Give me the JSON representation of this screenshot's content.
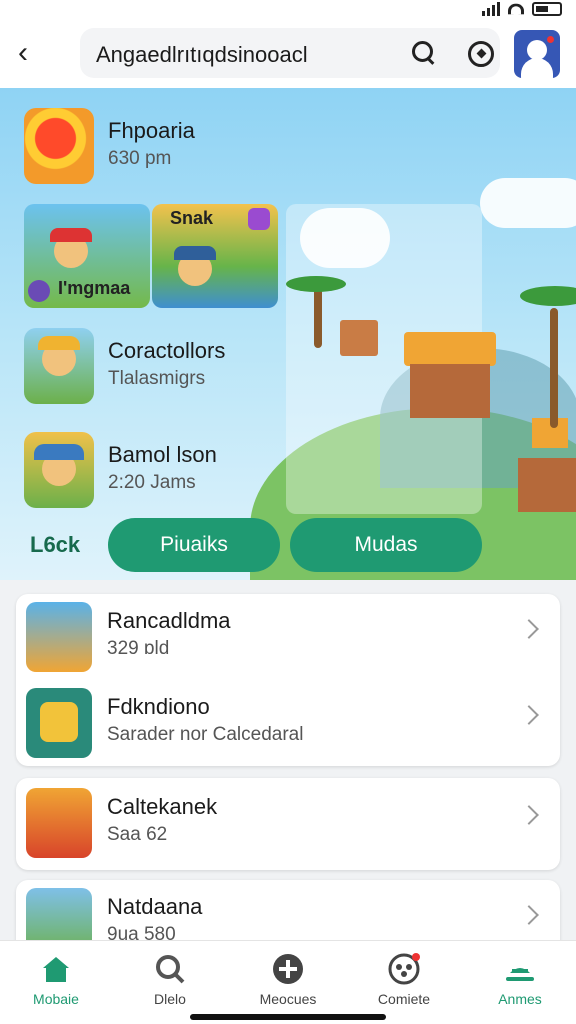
{
  "header": {
    "search_text": "Angaedlrıtıqdsinooacl"
  },
  "hero": {
    "top_game": {
      "title": "Fhpoaria",
      "subtitle": "630 pm"
    },
    "featured": [
      {
        "label": "I'mgmaa"
      },
      {
        "label": "Snak"
      }
    ],
    "games": [
      {
        "title": "Coractollors",
        "subtitle": "Tlalasmigrs"
      },
      {
        "title": "Bamol lson",
        "subtitle": "2:20 Jams"
      }
    ],
    "look_label": "L6ck",
    "buttons": [
      {
        "label": "Piuaiks"
      },
      {
        "label": "Mudas"
      }
    ]
  },
  "list": [
    {
      "title": "Rancadldma",
      "subtitle": "329 ɒld"
    },
    {
      "title": "Fdkndiono",
      "subtitle": "Sarader nor Calcedaral"
    },
    {
      "title": "Caltekanek",
      "subtitle": "Saa 62"
    },
    {
      "title": "Natdaana",
      "subtitle": "9ua 580"
    }
  ],
  "nav": [
    {
      "label": "Mobaie",
      "icon": "home-icon",
      "active": true
    },
    {
      "label": "Dlelo",
      "icon": "search-icon",
      "active": false
    },
    {
      "label": "Meocues",
      "icon": "plus-icon",
      "active": false
    },
    {
      "label": "Comiete",
      "icon": "gamepad-icon",
      "active": false
    },
    {
      "label": "Anmes",
      "icon": "ship-icon",
      "active": false
    }
  ],
  "colors": {
    "accent": "#1f9a72",
    "brand_dark": "#176a4d",
    "sky": "#8fd3f4"
  }
}
